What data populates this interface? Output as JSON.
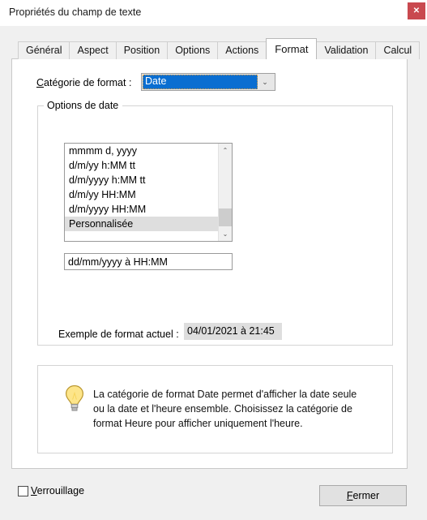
{
  "window": {
    "title": "Propriétés du champ de texte",
    "close_glyph": "✕",
    "close_icon_name": "window-close-icon",
    "accent_close_color": "#c9494f"
  },
  "tabs": [
    {
      "label": "Général",
      "active": false
    },
    {
      "label": "Aspect",
      "active": false
    },
    {
      "label": "Position",
      "active": false
    },
    {
      "label": "Options",
      "active": false
    },
    {
      "label": "Actions",
      "active": false
    },
    {
      "label": "Format",
      "active": true
    },
    {
      "label": "Validation",
      "active": false
    },
    {
      "label": "Calcul",
      "active": false
    }
  ],
  "format_tab": {
    "category": {
      "label_prefix": "C",
      "label_rest": "atégorie de format :",
      "selected_value": "Date",
      "arrow_glyph": "⌄",
      "highlight_color": "#0a6ed1"
    },
    "group": {
      "legend": "Options de date",
      "listbox": {
        "items": [
          "mmmm d, yyyy",
          "d/m/yy h:MM tt",
          "d/m/yyyy h:MM tt",
          "d/m/yy HH:MM",
          "d/m/yyyy HH:MM",
          "Personnalisée"
        ],
        "selected_index": 5,
        "scroll_up_glyph": "⌃",
        "scroll_down_glyph": "⌄"
      },
      "custom_format": {
        "value": "dd/mm/yyyy à HH:MM",
        "placeholder": ""
      },
      "example": {
        "label": "Exemple de format actuel :",
        "value": "04/01/2021 à 21:45"
      }
    },
    "tip": {
      "icon_name": "lightbulb-icon",
      "text": "La catégorie de format Date permet d'afficher la date seule ou la date et l'heure ensemble. Choisissez la catégorie de format Heure pour afficher uniquement l'heure."
    }
  },
  "footer": {
    "lock": {
      "label_prefix": "V",
      "label_rest": "errouillage",
      "checked": false
    },
    "close_button": {
      "label_prefix": "F",
      "label_rest": "ermer"
    }
  }
}
